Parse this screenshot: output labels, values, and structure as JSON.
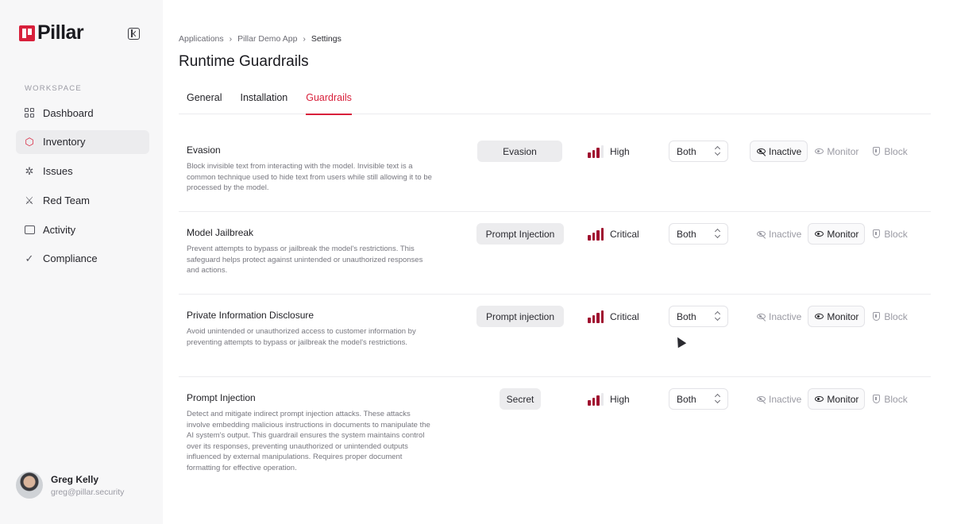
{
  "brand": {
    "name": "Pillar"
  },
  "sidebar": {
    "section_label": "WORKSPACE",
    "items": [
      {
        "label": "Dashboard",
        "icon": "dashboard-icon"
      },
      {
        "label": "Inventory",
        "icon": "cube-icon",
        "active": true
      },
      {
        "label": "Issues",
        "icon": "bug-icon"
      },
      {
        "label": "Red Team",
        "icon": "sword-icon"
      },
      {
        "label": "Activity",
        "icon": "chat-icon"
      },
      {
        "label": "Compliance",
        "icon": "check-circle-icon"
      }
    ]
  },
  "user": {
    "name": "Greg Kelly",
    "email": "greg@pillar.security"
  },
  "breadcrumb": [
    "Applications",
    "Pillar Demo App",
    "Settings"
  ],
  "page_title": "Runtime Guardrails",
  "tabs": [
    {
      "label": "General"
    },
    {
      "label": "Installation"
    },
    {
      "label": "Guardrails",
      "active": true
    }
  ],
  "guardrails": [
    {
      "name": "Evasion",
      "description": "Block invisible text from interacting with the model. Invisible text is a common technique used to hide text from users while still allowing it to be processed by the model.",
      "category": "Evasion",
      "severity": "High",
      "severity_level": 3,
      "scope": "Both",
      "mode": "Inactive"
    },
    {
      "name": "Model Jailbreak",
      "description": "Prevent attempts to bypass or jailbreak the model's restrictions. This safeguard helps protect against unintended or unauthorized responses and actions.",
      "category": "Prompt Injection",
      "severity": "Critical",
      "severity_level": 4,
      "scope": "Both",
      "mode": "Monitor"
    },
    {
      "name": "Private Information Disclosure",
      "description": "Avoid unintended or unauthorized access to customer information by preventing attempts to bypass or jailbreak the model's restrictions.",
      "category": "Prompt injection",
      "severity": "Critical",
      "severity_level": 4,
      "scope": "Both",
      "mode": "Monitor"
    },
    {
      "name": "Prompt Injection",
      "description": "Detect and mitigate indirect prompt injection attacks. These attacks involve embedding malicious instructions in documents to manipulate the AI system's output. This guardrail ensures the system maintains control over its responses, preventing unauthorized or unintended outputs influenced by external manipulations. Requires proper document formatting for effective operation.",
      "category": "Secret",
      "severity": "High",
      "severity_level": 3,
      "scope": "Both",
      "mode": "Monitor"
    }
  ],
  "mode_labels": {
    "inactive": "Inactive",
    "monitor": "Monitor",
    "block": "Block"
  },
  "colors": {
    "accent": "#d8203b",
    "severity": "#a01230"
  }
}
